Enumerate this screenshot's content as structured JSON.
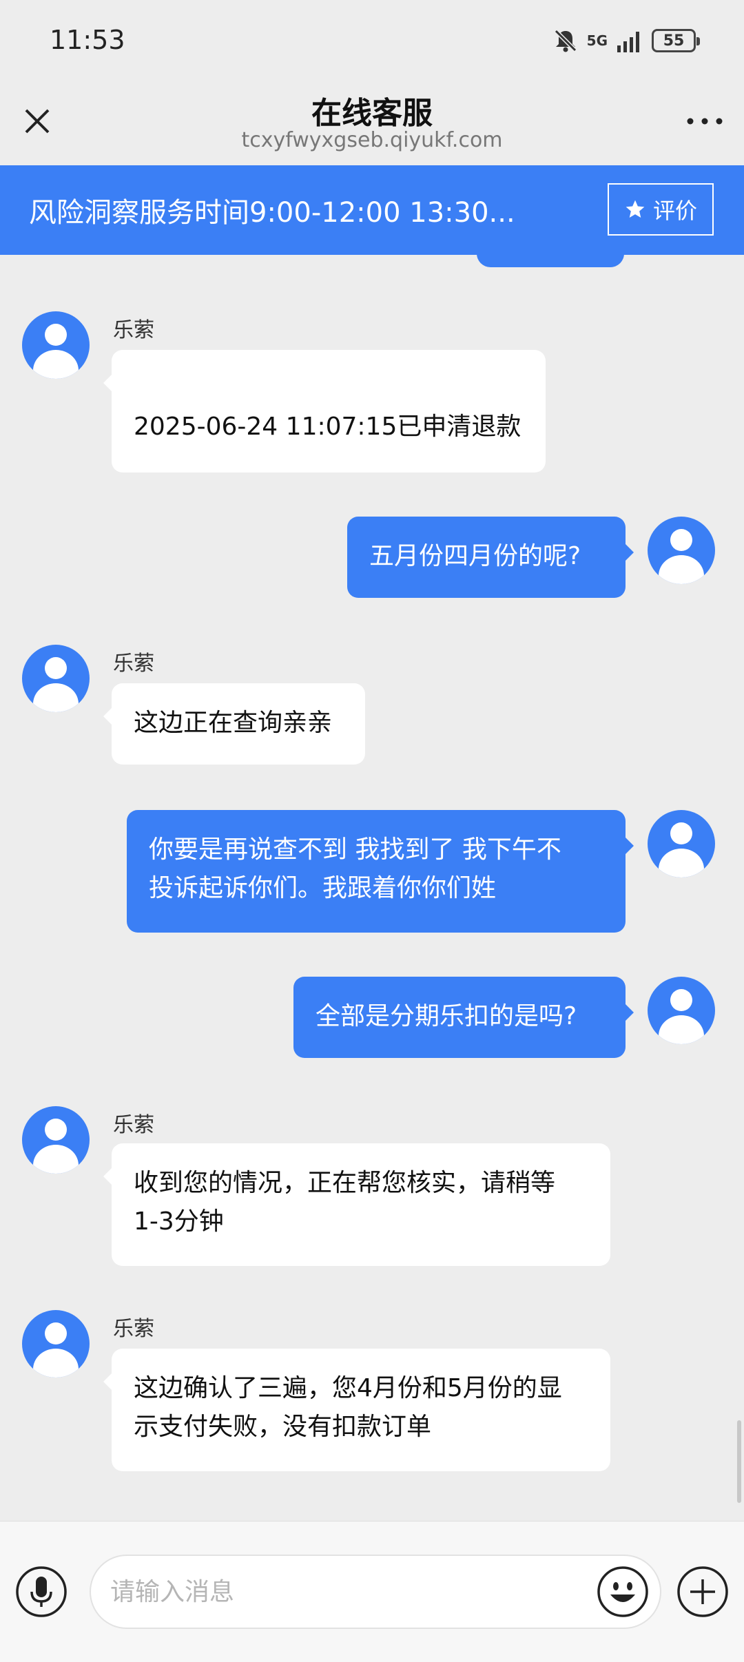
{
  "status_bar": {
    "time": "11:53",
    "network": "5G",
    "battery": "55"
  },
  "header": {
    "title": "在线客服",
    "url": "tcxyfwyxgseb.qiyukf.com"
  },
  "notice": {
    "text": "风险洞察服务时间9:00-12:00 13:30...",
    "rate_label": "评价"
  },
  "messages": [
    {
      "side": "left",
      "sender": "乐萦",
      "text": "2025-06-24 11:07:15已申清退款"
    },
    {
      "side": "right",
      "text": "五月份四月份的呢?"
    },
    {
      "side": "left",
      "sender": "乐萦",
      "text": "这边正在查询亲亲"
    },
    {
      "side": "right",
      "lines": [
        "你要是再说查不到 我找到了 我下午不",
        "投诉起诉你们。我跟着你你们姓"
      ]
    },
    {
      "side": "right",
      "text": "全部是分期乐扣的是吗?"
    },
    {
      "side": "left",
      "sender": "乐萦",
      "lines": [
        "收到您的情况，正在帮您核实，请稍等",
        "1-3分钟"
      ]
    },
    {
      "side": "left",
      "sender": "乐萦",
      "lines": [
        "这边确认了三遍，您4月份和5月份的显",
        "示支付失败，没有扣款订单"
      ]
    }
  ],
  "input": {
    "placeholder": "请输入消息"
  },
  "colors": {
    "accent": "#3b7ff5",
    "background": "#ededed",
    "bubble_left": "#ffffff"
  }
}
